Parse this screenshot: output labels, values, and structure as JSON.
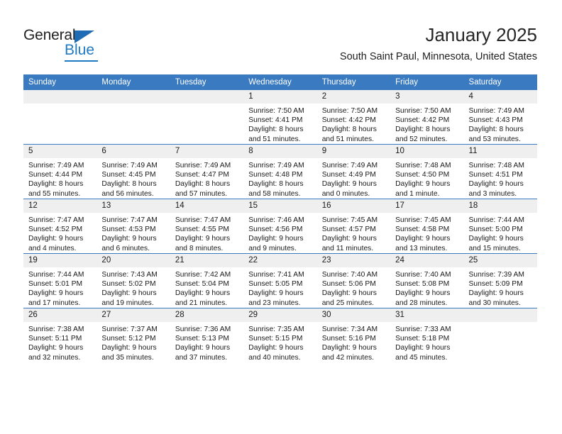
{
  "brand": {
    "name_dark": "General",
    "name_blue": "Blue",
    "accent_color": "#1f7ac4",
    "header_color": "#3a7ac0"
  },
  "header": {
    "title": "January 2025",
    "subtitle": "South Saint Paul, Minnesota, United States"
  },
  "calendar": {
    "weekday_headers": [
      "Sunday",
      "Monday",
      "Tuesday",
      "Wednesday",
      "Thursday",
      "Friday",
      "Saturday"
    ],
    "weeks": [
      [
        {
          "day": "",
          "empty": true
        },
        {
          "day": "",
          "empty": true
        },
        {
          "day": "",
          "empty": true
        },
        {
          "day": "1",
          "sunrise": "Sunrise: 7:50 AM",
          "sunset": "Sunset: 4:41 PM",
          "daylight_1": "Daylight: 8 hours",
          "daylight_2": "and 51 minutes."
        },
        {
          "day": "2",
          "sunrise": "Sunrise: 7:50 AM",
          "sunset": "Sunset: 4:42 PM",
          "daylight_1": "Daylight: 8 hours",
          "daylight_2": "and 51 minutes."
        },
        {
          "day": "3",
          "sunrise": "Sunrise: 7:50 AM",
          "sunset": "Sunset: 4:42 PM",
          "daylight_1": "Daylight: 8 hours",
          "daylight_2": "and 52 minutes."
        },
        {
          "day": "4",
          "sunrise": "Sunrise: 7:49 AM",
          "sunset": "Sunset: 4:43 PM",
          "daylight_1": "Daylight: 8 hours",
          "daylight_2": "and 53 minutes."
        }
      ],
      [
        {
          "day": "5",
          "sunrise": "Sunrise: 7:49 AM",
          "sunset": "Sunset: 4:44 PM",
          "daylight_1": "Daylight: 8 hours",
          "daylight_2": "and 55 minutes."
        },
        {
          "day": "6",
          "sunrise": "Sunrise: 7:49 AM",
          "sunset": "Sunset: 4:45 PM",
          "daylight_1": "Daylight: 8 hours",
          "daylight_2": "and 56 minutes."
        },
        {
          "day": "7",
          "sunrise": "Sunrise: 7:49 AM",
          "sunset": "Sunset: 4:47 PM",
          "daylight_1": "Daylight: 8 hours",
          "daylight_2": "and 57 minutes."
        },
        {
          "day": "8",
          "sunrise": "Sunrise: 7:49 AM",
          "sunset": "Sunset: 4:48 PM",
          "daylight_1": "Daylight: 8 hours",
          "daylight_2": "and 58 minutes."
        },
        {
          "day": "9",
          "sunrise": "Sunrise: 7:49 AM",
          "sunset": "Sunset: 4:49 PM",
          "daylight_1": "Daylight: 9 hours",
          "daylight_2": "and 0 minutes."
        },
        {
          "day": "10",
          "sunrise": "Sunrise: 7:48 AM",
          "sunset": "Sunset: 4:50 PM",
          "daylight_1": "Daylight: 9 hours",
          "daylight_2": "and 1 minute."
        },
        {
          "day": "11",
          "sunrise": "Sunrise: 7:48 AM",
          "sunset": "Sunset: 4:51 PM",
          "daylight_1": "Daylight: 9 hours",
          "daylight_2": "and 3 minutes."
        }
      ],
      [
        {
          "day": "12",
          "sunrise": "Sunrise: 7:47 AM",
          "sunset": "Sunset: 4:52 PM",
          "daylight_1": "Daylight: 9 hours",
          "daylight_2": "and 4 minutes."
        },
        {
          "day": "13",
          "sunrise": "Sunrise: 7:47 AM",
          "sunset": "Sunset: 4:53 PM",
          "daylight_1": "Daylight: 9 hours",
          "daylight_2": "and 6 minutes."
        },
        {
          "day": "14",
          "sunrise": "Sunrise: 7:47 AM",
          "sunset": "Sunset: 4:55 PM",
          "daylight_1": "Daylight: 9 hours",
          "daylight_2": "and 8 minutes."
        },
        {
          "day": "15",
          "sunrise": "Sunrise: 7:46 AM",
          "sunset": "Sunset: 4:56 PM",
          "daylight_1": "Daylight: 9 hours",
          "daylight_2": "and 9 minutes."
        },
        {
          "day": "16",
          "sunrise": "Sunrise: 7:45 AM",
          "sunset": "Sunset: 4:57 PM",
          "daylight_1": "Daylight: 9 hours",
          "daylight_2": "and 11 minutes."
        },
        {
          "day": "17",
          "sunrise": "Sunrise: 7:45 AM",
          "sunset": "Sunset: 4:58 PM",
          "daylight_1": "Daylight: 9 hours",
          "daylight_2": "and 13 minutes."
        },
        {
          "day": "18",
          "sunrise": "Sunrise: 7:44 AM",
          "sunset": "Sunset: 5:00 PM",
          "daylight_1": "Daylight: 9 hours",
          "daylight_2": "and 15 minutes."
        }
      ],
      [
        {
          "day": "19",
          "sunrise": "Sunrise: 7:44 AM",
          "sunset": "Sunset: 5:01 PM",
          "daylight_1": "Daylight: 9 hours",
          "daylight_2": "and 17 minutes."
        },
        {
          "day": "20",
          "sunrise": "Sunrise: 7:43 AM",
          "sunset": "Sunset: 5:02 PM",
          "daylight_1": "Daylight: 9 hours",
          "daylight_2": "and 19 minutes."
        },
        {
          "day": "21",
          "sunrise": "Sunrise: 7:42 AM",
          "sunset": "Sunset: 5:04 PM",
          "daylight_1": "Daylight: 9 hours",
          "daylight_2": "and 21 minutes."
        },
        {
          "day": "22",
          "sunrise": "Sunrise: 7:41 AM",
          "sunset": "Sunset: 5:05 PM",
          "daylight_1": "Daylight: 9 hours",
          "daylight_2": "and 23 minutes."
        },
        {
          "day": "23",
          "sunrise": "Sunrise: 7:40 AM",
          "sunset": "Sunset: 5:06 PM",
          "daylight_1": "Daylight: 9 hours",
          "daylight_2": "and 25 minutes."
        },
        {
          "day": "24",
          "sunrise": "Sunrise: 7:40 AM",
          "sunset": "Sunset: 5:08 PM",
          "daylight_1": "Daylight: 9 hours",
          "daylight_2": "and 28 minutes."
        },
        {
          "day": "25",
          "sunrise": "Sunrise: 7:39 AM",
          "sunset": "Sunset: 5:09 PM",
          "daylight_1": "Daylight: 9 hours",
          "daylight_2": "and 30 minutes."
        }
      ],
      [
        {
          "day": "26",
          "sunrise": "Sunrise: 7:38 AM",
          "sunset": "Sunset: 5:11 PM",
          "daylight_1": "Daylight: 9 hours",
          "daylight_2": "and 32 minutes."
        },
        {
          "day": "27",
          "sunrise": "Sunrise: 7:37 AM",
          "sunset": "Sunset: 5:12 PM",
          "daylight_1": "Daylight: 9 hours",
          "daylight_2": "and 35 minutes."
        },
        {
          "day": "28",
          "sunrise": "Sunrise: 7:36 AM",
          "sunset": "Sunset: 5:13 PM",
          "daylight_1": "Daylight: 9 hours",
          "daylight_2": "and 37 minutes."
        },
        {
          "day": "29",
          "sunrise": "Sunrise: 7:35 AM",
          "sunset": "Sunset: 5:15 PM",
          "daylight_1": "Daylight: 9 hours",
          "daylight_2": "and 40 minutes."
        },
        {
          "day": "30",
          "sunrise": "Sunrise: 7:34 AM",
          "sunset": "Sunset: 5:16 PM",
          "daylight_1": "Daylight: 9 hours",
          "daylight_2": "and 42 minutes."
        },
        {
          "day": "31",
          "sunrise": "Sunrise: 7:33 AM",
          "sunset": "Sunset: 5:18 PM",
          "daylight_1": "Daylight: 9 hours",
          "daylight_2": "and 45 minutes."
        },
        {
          "day": "",
          "empty": true
        }
      ]
    ]
  }
}
